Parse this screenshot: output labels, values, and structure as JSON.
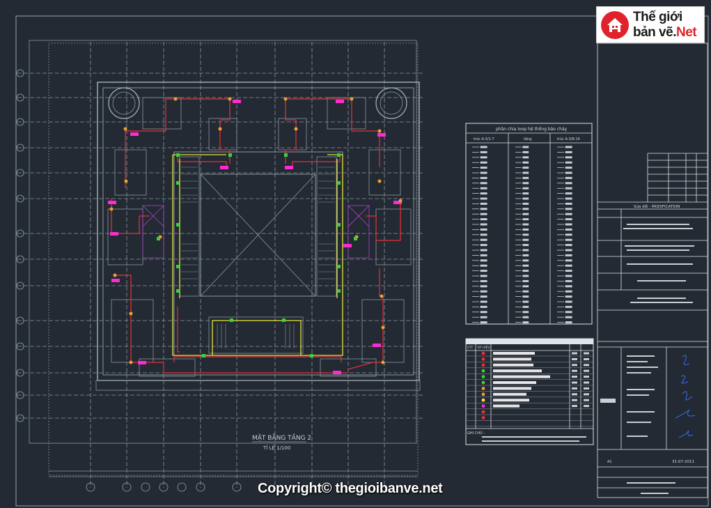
{
  "logo": {
    "line1": "Thế giới",
    "line2_prefix": "bản vẽ.",
    "line2_suffix": "Net"
  },
  "copyright": "Copyright© thegioibanve.net",
  "plan": {
    "title": "MẶT BẰNG TẦNG 2",
    "scale": "TỈ LỆ 1/100"
  },
  "loop_table": {
    "title": "phân chia loop hệ thống báo cháy",
    "col1": "trúc A-3/1-7",
    "col2": "tầng",
    "col3": "trúc A-3/8-14"
  },
  "legend_table": {
    "col_stt": "STT",
    "col_symbol": "KÝ HIỆU",
    "note": "GHI CHÚ :"
  },
  "title_block": {
    "revision": "Sửa đổi - MODIFICATION",
    "date": "31-07-2011",
    "sheet": "A1"
  },
  "colors": {
    "background": "#232a33",
    "wall": "#8c96a0",
    "red_wire": "#e8303a",
    "yellow_wire": "#e8e83a",
    "magenta": "#ff2ad0",
    "green_device": "#3cd23c",
    "orange_device": "#f0a030"
  }
}
